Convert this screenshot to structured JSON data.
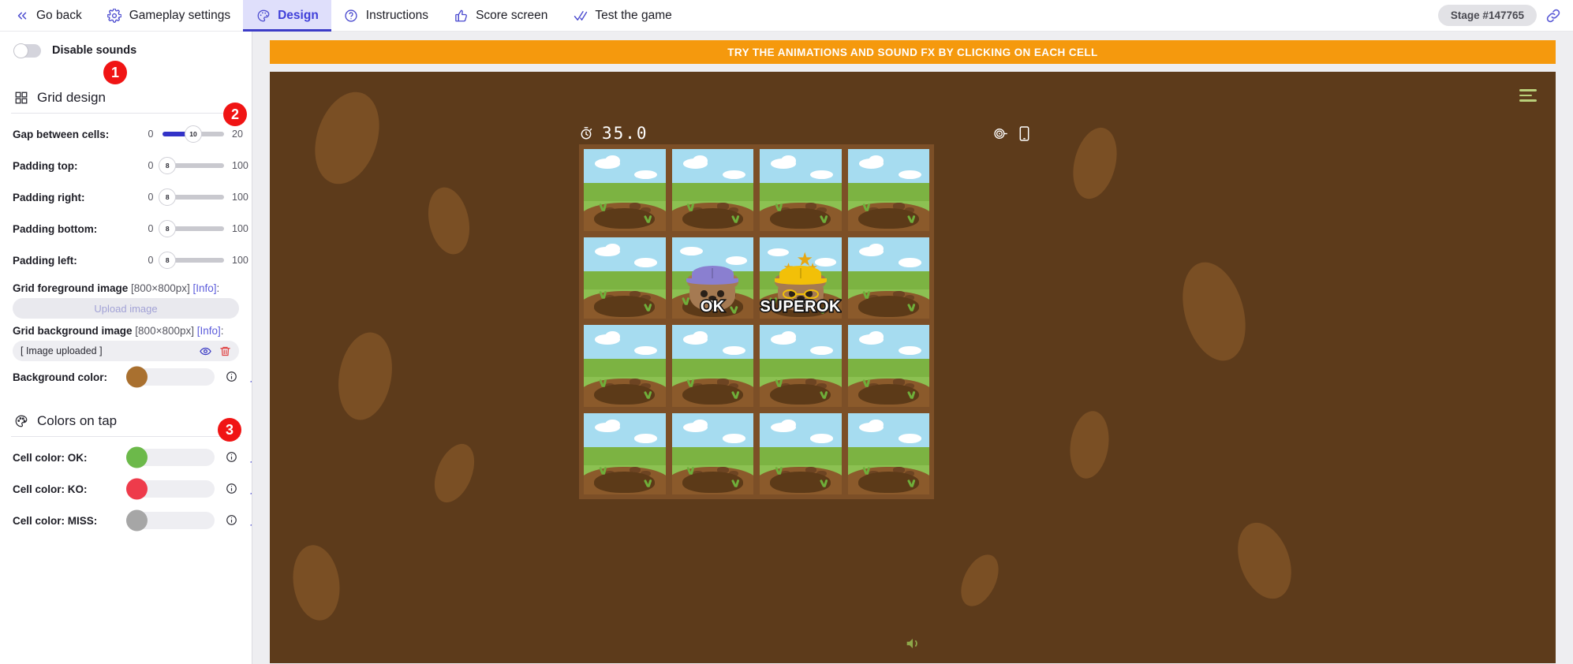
{
  "topnav": {
    "items": [
      {
        "label": "Go back",
        "icon": "chevrons-left-icon",
        "active": false
      },
      {
        "label": "Gameplay settings",
        "icon": "gear-icon",
        "active": false
      },
      {
        "label": "Design",
        "icon": "palette-icon",
        "active": true
      },
      {
        "label": "Instructions",
        "icon": "question-circle-icon",
        "active": false
      },
      {
        "label": "Score screen",
        "icon": "thumbs-up-icon",
        "active": false
      },
      {
        "label": "Test the game",
        "icon": "double-check-icon",
        "active": false
      }
    ],
    "stage_chip": "Stage #147765",
    "link_icon": "link-icon"
  },
  "sidebar": {
    "disable_sounds": {
      "label": "Disable sounds",
      "on": false
    },
    "badges": [
      "1",
      "2",
      "3"
    ],
    "grid_design": {
      "title": "Grid design",
      "icon": "grid-icon",
      "sliders": [
        {
          "label": "Gap between cells:",
          "min": "0",
          "max": "20",
          "value": "10",
          "fill_pct": 50
        },
        {
          "label": "Padding top:",
          "min": "0",
          "max": "100",
          "value": "8",
          "fill_pct": 8
        },
        {
          "label": "Padding right:",
          "min": "0",
          "max": "100",
          "value": "8",
          "fill_pct": 8
        },
        {
          "label": "Padding bottom:",
          "min": "0",
          "max": "100",
          "value": "8",
          "fill_pct": 8
        },
        {
          "label": "Padding left:",
          "min": "0",
          "max": "100",
          "value": "8",
          "fill_pct": 8
        }
      ],
      "foreground_image": {
        "label": "Grid foreground image",
        "dims": "[800×800px]",
        "info": "[Info]",
        "colon": ":",
        "button": "Upload image"
      },
      "background_image": {
        "label": "Grid background image",
        "dims": "[800×800px]",
        "info": "[Info]",
        "colon": ":",
        "status": "[ Image uploaded ]",
        "eye_icon": "eye-icon",
        "trash_icon": "trash-icon"
      },
      "background_color": {
        "label": "Background color:",
        "color": "#a9702f",
        "info_icon": "info-icon",
        "picker_icon": "eyedropper-icon"
      }
    },
    "colors_on_tap": {
      "title": "Colors on tap",
      "icon": "palette-dots-icon",
      "rows": [
        {
          "label": "Cell color: OK:",
          "color": "#6cb94a",
          "info_icon": "info-icon",
          "picker_icon": "eyedropper-icon"
        },
        {
          "label": "Cell color: KO:",
          "color": "#ee3b4b",
          "info_icon": "info-icon",
          "picker_icon": "eyedropper-icon"
        },
        {
          "label": "Cell color: MISS:",
          "color": "#a6a6a6",
          "info_icon": "info-icon",
          "picker_icon": "eyedropper-icon"
        }
      ]
    }
  },
  "preview": {
    "banner": "TRY THE ANIMATIONS AND SOUND FX BY CLICKING ON EACH CELL",
    "stage_bg_color": "#5d3b1b",
    "menu_icon": "hamburger-menu-icon",
    "hud": {
      "timer": "35.0",
      "timer_icon": "stopwatch-icon",
      "target_icon": "target-icon",
      "device_icon": "mobile-device-icon"
    },
    "sound_icon": "speaker-icon",
    "grid": {
      "columns": 4,
      "rows": 4,
      "cells": [
        {
          "id": "r1c1",
          "state": "empty",
          "caption": ""
        },
        {
          "id": "r1c2",
          "state": "empty",
          "caption": ""
        },
        {
          "id": "r1c3",
          "state": "empty",
          "caption": ""
        },
        {
          "id": "r1c4",
          "state": "empty",
          "caption": ""
        },
        {
          "id": "r2c1",
          "state": "empty",
          "caption": ""
        },
        {
          "id": "r2c2",
          "state": "mole-ok",
          "caption": "OK"
        },
        {
          "id": "r2c3",
          "state": "mole-superok",
          "caption": "SUPEROK"
        },
        {
          "id": "r2c4",
          "state": "empty",
          "caption": ""
        },
        {
          "id": "r3c1",
          "state": "empty",
          "caption": ""
        },
        {
          "id": "r3c2",
          "state": "empty",
          "caption": ""
        },
        {
          "id": "r3c3",
          "state": "empty",
          "caption": ""
        },
        {
          "id": "r3c4",
          "state": "empty",
          "caption": ""
        },
        {
          "id": "r4c1",
          "state": "empty",
          "caption": ""
        },
        {
          "id": "r4c2",
          "state": "empty",
          "caption": ""
        },
        {
          "id": "r4c3",
          "state": "empty",
          "caption": ""
        },
        {
          "id": "r4c4",
          "state": "empty",
          "caption": ""
        }
      ]
    }
  }
}
